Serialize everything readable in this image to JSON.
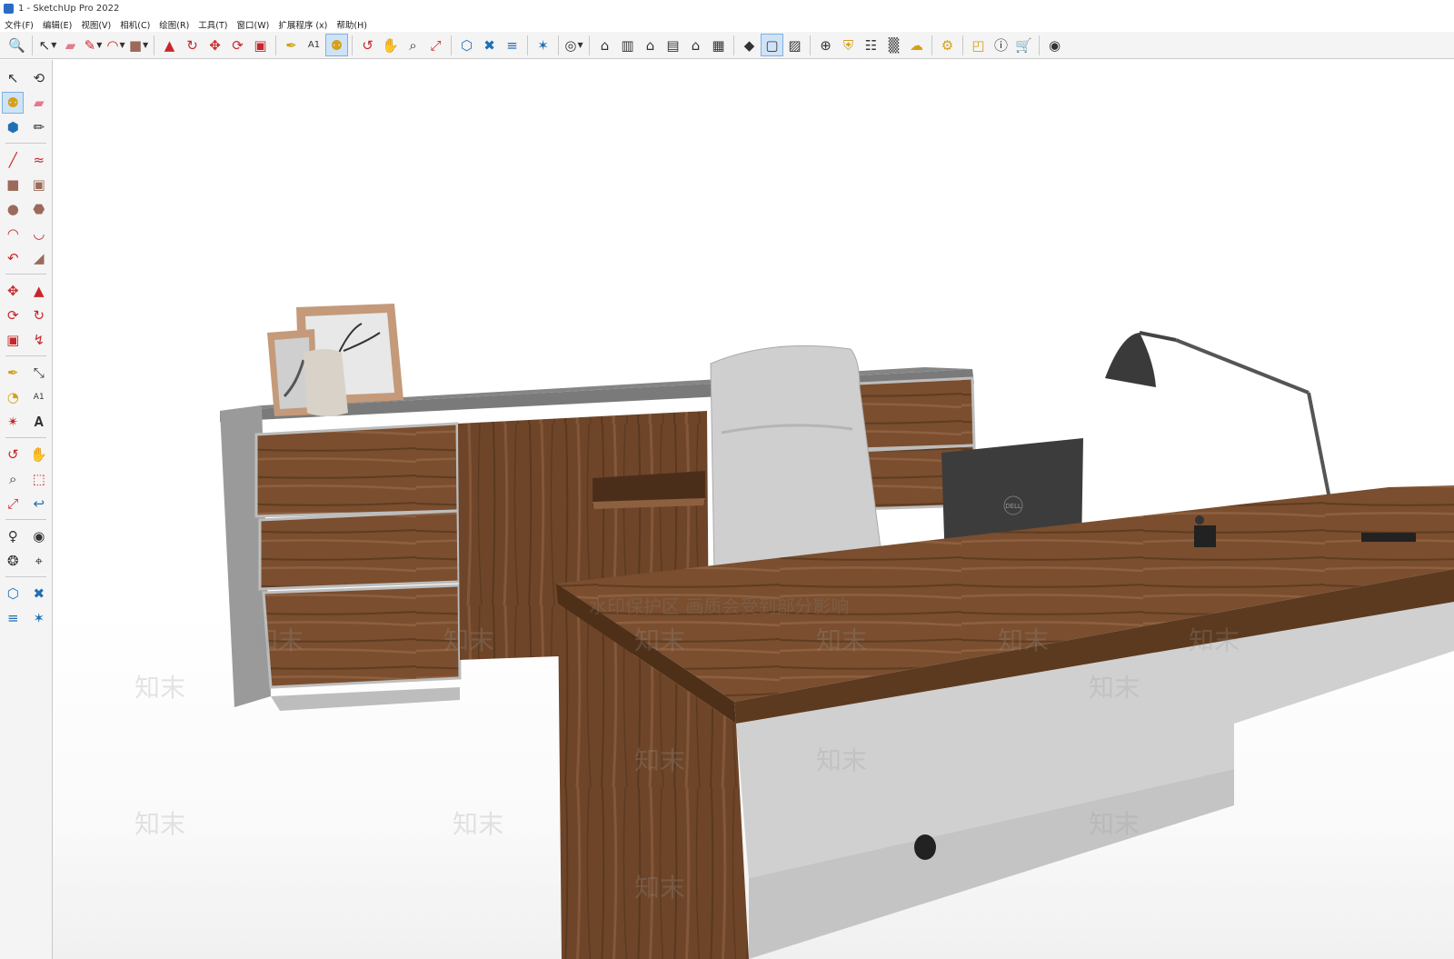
{
  "window": {
    "title": "1 - SketchUp Pro 2022"
  },
  "menu": [
    "文件(F)",
    "编辑(E)",
    "视图(V)",
    "相机(C)",
    "绘图(R)",
    "工具(T)",
    "窗口(W)",
    "扩展程序 (x)",
    "帮助(H)"
  ],
  "toolbar": {
    "top_icons": [
      "search-icon",
      "select-icon",
      "eraser-icon",
      "pencil-icon",
      "arc-icon",
      "rectangle-icon",
      "pushpull-icon",
      "followme-icon",
      "move-icon",
      "rotate-icon",
      "scale-icon",
      "tape-icon",
      "text-icon",
      "paint-icon",
      "orbit-icon",
      "pan-icon",
      "zoom-icon",
      "zoom-extents-icon",
      "warehouse-icon",
      "extension-icon",
      "layout-icon",
      "style-icon",
      "account-icon",
      "iso-view-icon",
      "front-view-icon",
      "top-view-icon",
      "right-view-icon",
      "back-view-icon",
      "left-view-icon",
      "section-plane-icon",
      "section-display-icon",
      "scenes-icon",
      "add-location-icon",
      "shadow-icon",
      "report-icon",
      "checker-icon",
      "upload-icon",
      "settings-icon",
      "components-icon",
      "info-icon",
      "cart-icon",
      "user-icon"
    ]
  },
  "viewport": {
    "watermark_text": "水印保护区 画质会受到部分影响",
    "watermark_logo": "知末",
    "laptop_brand": "DELL"
  },
  "colors": {
    "wood_dark": "#5a3a22",
    "wood_mid": "#7a4e2e",
    "cabinet_gray": "#8c8c8c",
    "desk_panel": "#c9c9c9",
    "accent_active": "#cfe3f7"
  }
}
